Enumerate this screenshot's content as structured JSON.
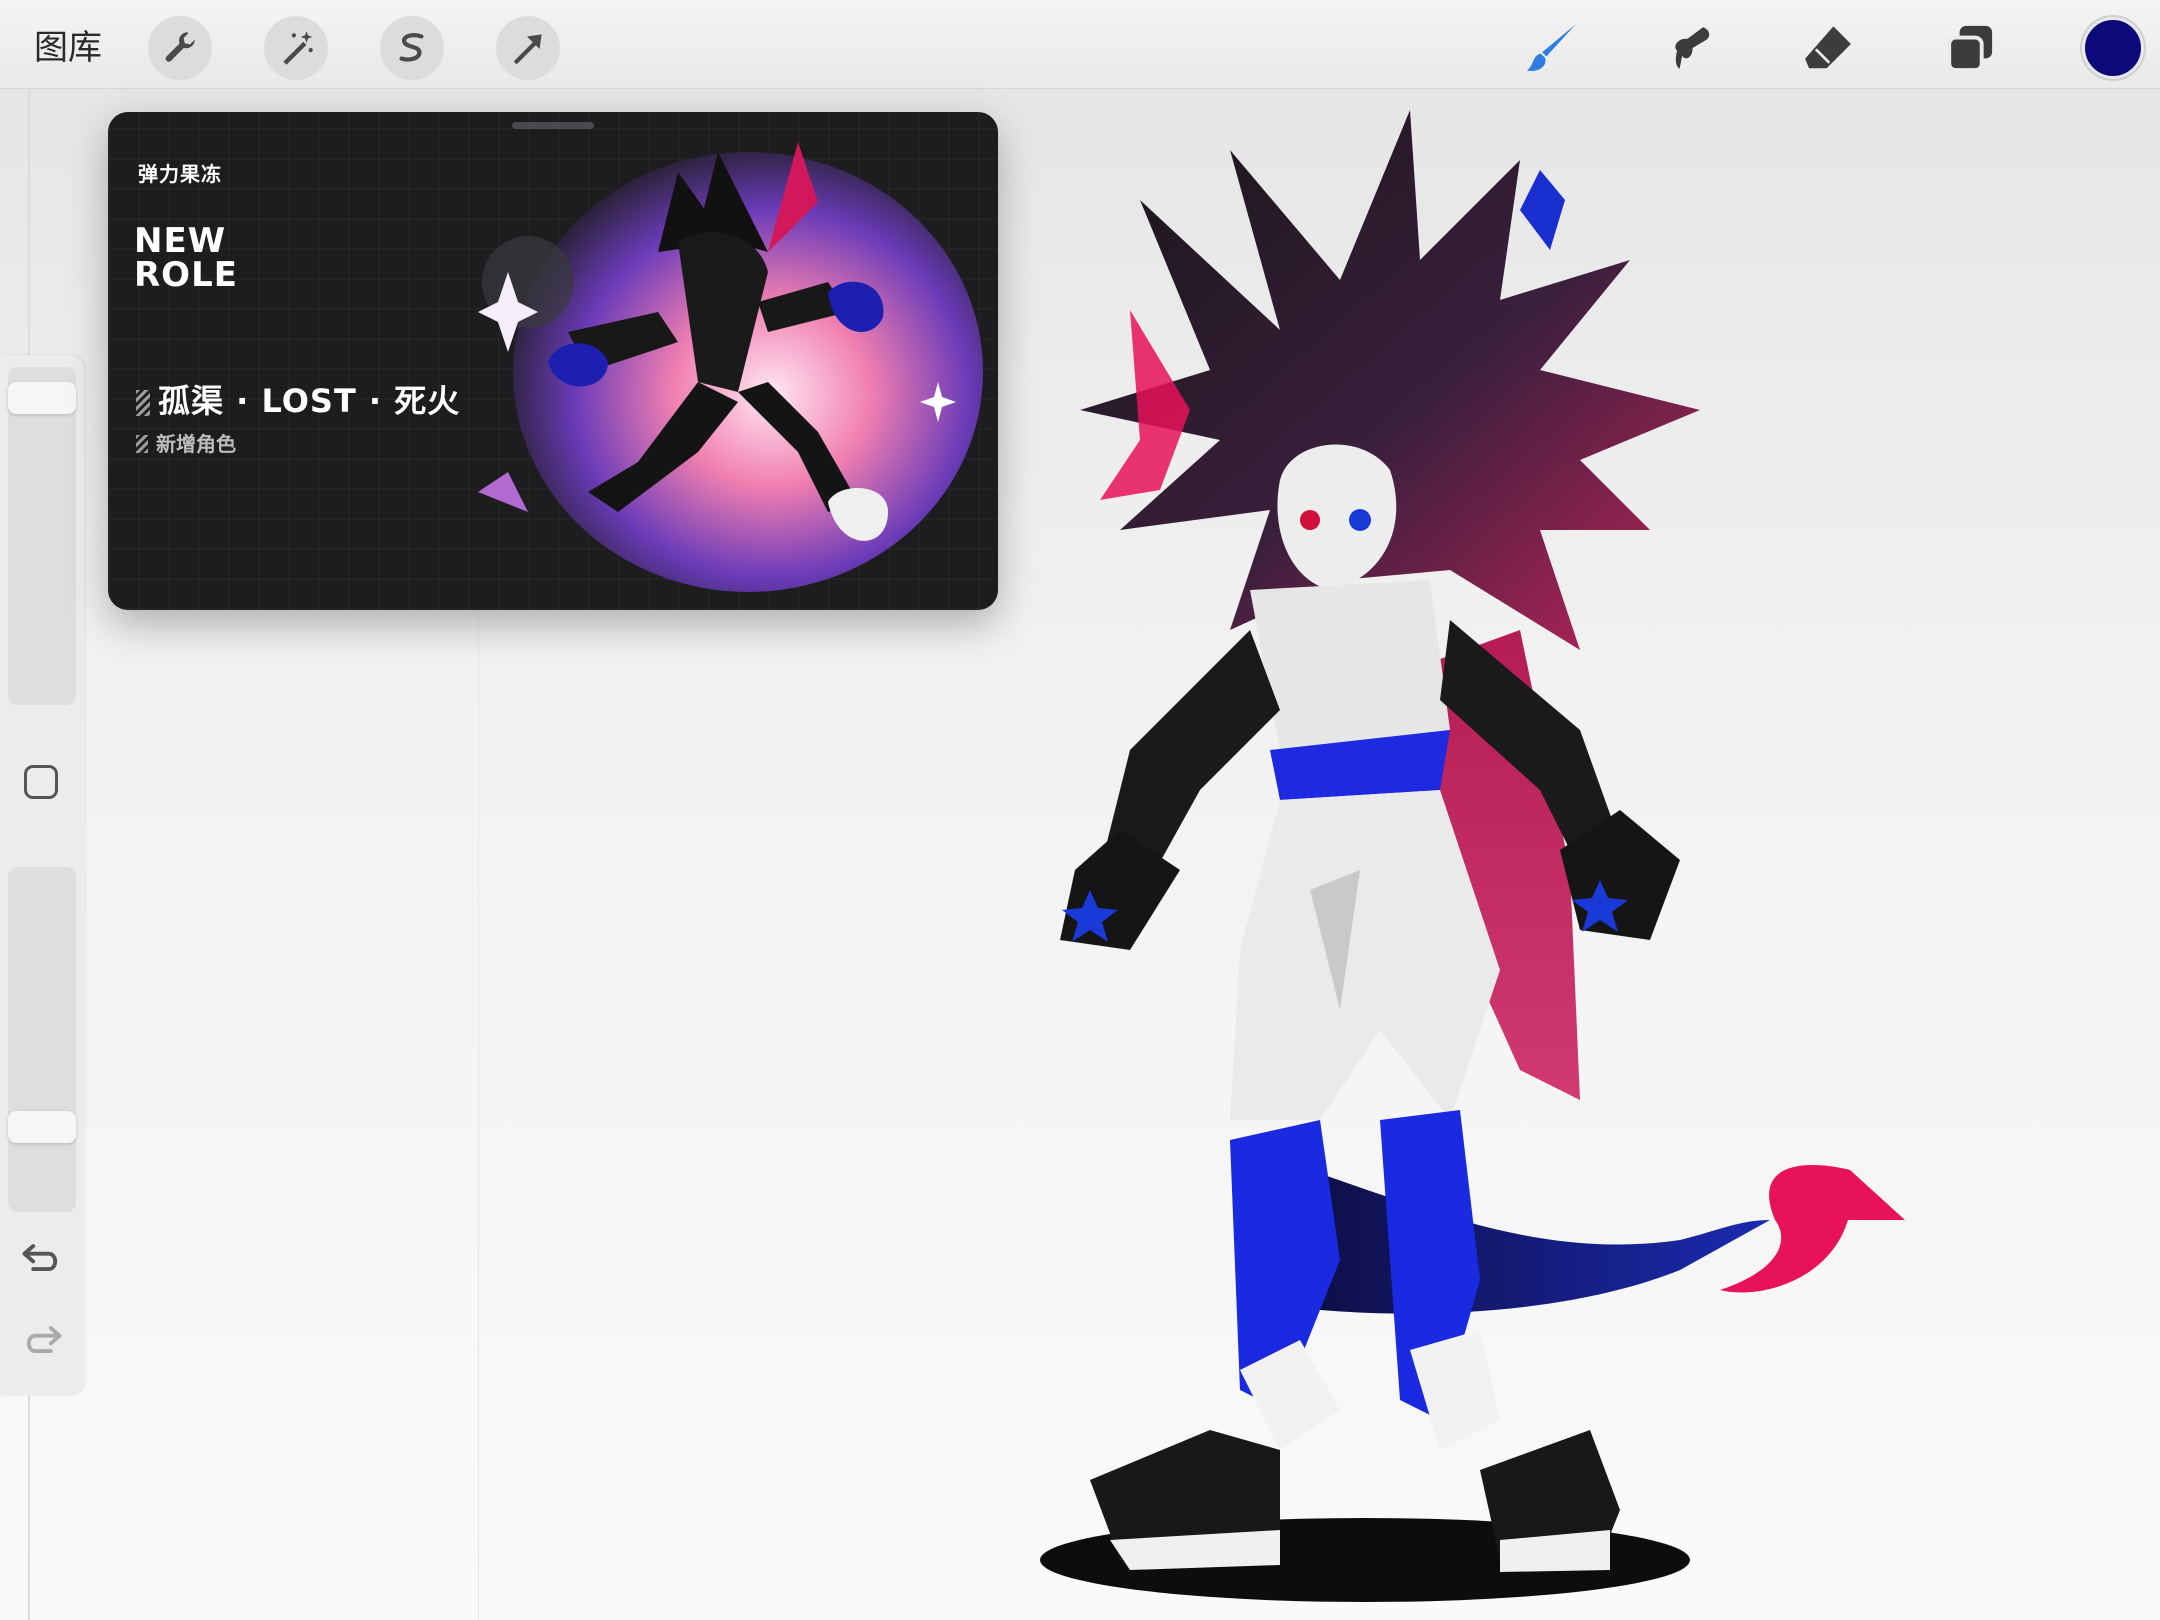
{
  "toolbar": {
    "gallery_label": "图库",
    "left_tools": [
      "wrench-icon",
      "magic-wand-icon",
      "selection-s-icon",
      "transform-arrow-icon"
    ],
    "right_tools": [
      "brush-icon",
      "smudge-icon",
      "eraser-icon",
      "layers-icon"
    ],
    "current_color": "#0c0a7a",
    "accent_color": "#2f7de1"
  },
  "sidebar": {
    "brush_size_level": 0.05,
    "opacity_level": 0.78,
    "modifier": "square-modifier-icon",
    "undo": "undo-icon",
    "redo": "redo-icon"
  },
  "reference_card": {
    "brand": "弹力果冻",
    "new_role": "NEW ROLE",
    "role_name": "孤渠 · LOST · 死火",
    "role_subtitle": "新增角色"
  }
}
